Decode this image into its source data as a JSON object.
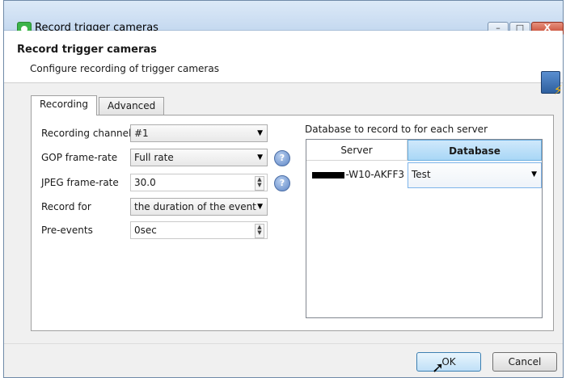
{
  "window": {
    "title": "Record trigger cameras",
    "close_label": "X",
    "min_label": "–",
    "max_label": "□"
  },
  "header": {
    "title": "Record trigger cameras",
    "subtitle": "Configure recording of trigger cameras"
  },
  "tabs": [
    {
      "label": "Recording"
    },
    {
      "label": "Advanced"
    }
  ],
  "form": {
    "recording_channel": {
      "label": "Recording channel",
      "value": "#1"
    },
    "gop_frame_rate": {
      "label": "GOP frame-rate",
      "value": "Full rate"
    },
    "jpeg_frame_rate": {
      "label": "JPEG frame-rate",
      "value": "30.0"
    },
    "record_for": {
      "label": "Record for",
      "value": "the duration of the event"
    },
    "pre_events": {
      "label": "Pre-events",
      "value": "0sec"
    }
  },
  "database_section": {
    "label": "Database to record to for each server",
    "columns": [
      "Server",
      "Database"
    ],
    "rows": [
      {
        "server": "-W10-AKFF3",
        "database": "Test"
      }
    ]
  },
  "buttons": {
    "ok": "OK",
    "cancel": "Cancel"
  },
  "icons": {
    "help": "?",
    "dropdown": "▼",
    "spin_up": "▲",
    "spin_down": "▼"
  }
}
